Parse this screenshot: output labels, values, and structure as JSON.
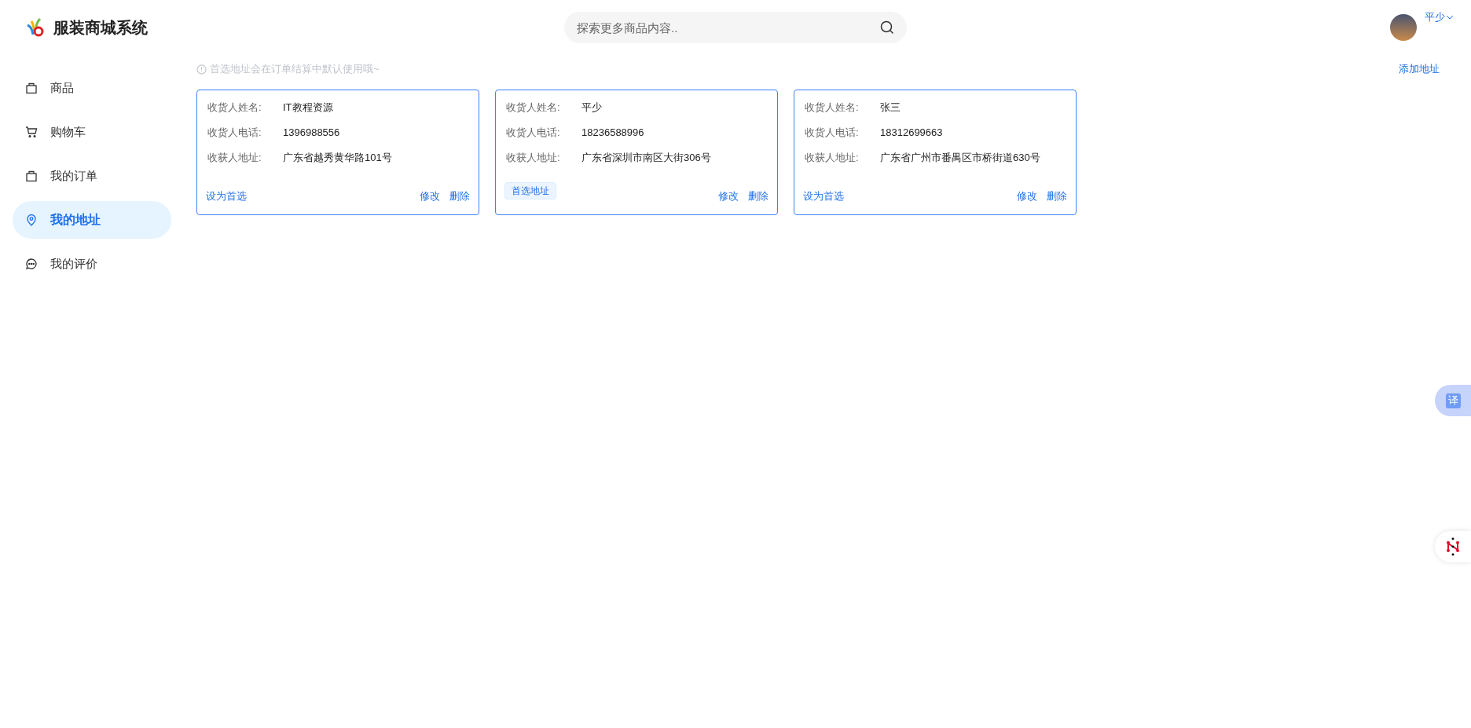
{
  "header": {
    "brand": "服装商城系统",
    "search": {
      "placeholder": "探索更多商品内容.."
    },
    "user": {
      "name": "平少"
    }
  },
  "sidebar": {
    "items": [
      {
        "label": "商品",
        "selected": false
      },
      {
        "label": "购物车",
        "selected": false
      },
      {
        "label": "我的订单",
        "selected": false
      },
      {
        "label": "我的地址",
        "selected": true
      },
      {
        "label": "我的评价",
        "selected": false
      }
    ]
  },
  "main": {
    "hint": "首选地址会在订单结算中默认使用哦~",
    "add_button": "添加地址",
    "addresses": [
      {
        "fields": [
          {
            "label": "收货人姓名:",
            "value": "IT教程资源"
          },
          {
            "label": "收货人电话:",
            "value": "1396988556"
          },
          {
            "label": "收获人地址:",
            "value": "广东省越秀黄华路101号"
          }
        ],
        "preferred": false,
        "set_preferred": "设为首选",
        "edit": "修改",
        "delete": "删除"
      },
      {
        "fields": [
          {
            "label": "收货人姓名:",
            "value": "平少"
          },
          {
            "label": "收货人电话:",
            "value": "18236588996"
          },
          {
            "label": "收获人地址:",
            "value": "广东省深圳市南区大街306号"
          }
        ],
        "preferred": true,
        "preferred_tag": "首选地址",
        "edit": "修改",
        "delete": "删除"
      },
      {
        "fields": [
          {
            "label": "收货人姓名:",
            "value": "张三"
          },
          {
            "label": "收货人电话:",
            "value": "18312699663"
          },
          {
            "label": "收获人地址:",
            "value": "广东省广州市番禺区市桥街道630号"
          }
        ],
        "preferred": false,
        "set_preferred": "设为首选",
        "edit": "修改",
        "delete": "删除"
      }
    ]
  },
  "floating": {
    "translate_label": "译"
  }
}
